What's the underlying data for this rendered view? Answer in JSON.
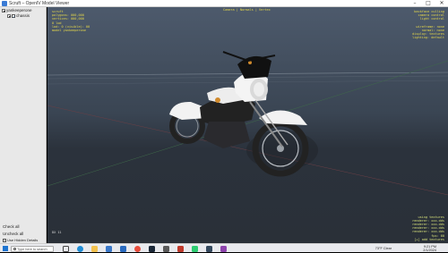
{
  "window": {
    "title": "Scruft – OpenIV Model Viewer",
    "min_glyph": "–",
    "max_glyph": "□",
    "close_glyph": "✕"
  },
  "tree": {
    "root": "yankeeperone",
    "child": "chassis",
    "check_glyph": "✓"
  },
  "sidebar": {
    "check_all": "Check all",
    "uncheck_all": "Uncheck all",
    "hide_option": "Use Hidden Details"
  },
  "hud": {
    "top": "Camera | Normals | Vertex",
    "left": "scruft\npolygons: 000,000\nvertices: 000,000\n0 lod\nlod: 0 (visible): 00\nmodel yankeeperone",
    "right": "backface culling\ncamera control\nlight control\n \nwireframe: none\nnormal: none\ndisplay: textures\nlighting: default",
    "bottom_right": "using textures\nrenderer: xxx.dds\nrenderer: xxx.dds\nrenderer: xxx.dds\nrenderer: xxx.dds\nfps: 60\n[+] add textures",
    "bottom_left": "DX 11"
  },
  "taskbar": {
    "search_placeholder": "Type here to search",
    "weather": "73°F Clear",
    "time": "9:21 PM",
    "date": "2/1/2024"
  },
  "colors": {
    "hud": "#e6d84a",
    "viewport": "#3a4553",
    "taskbar": "#e9eaee"
  },
  "icons": [
    "windows-start-icon",
    "search-icon",
    "task-view-icon",
    "edge-icon",
    "file-explorer-icon",
    "store-icon",
    "mail-icon",
    "chrome-icon",
    "steam-icon",
    "game-icon",
    "openiv-icon",
    "app-icon",
    "app-icon",
    "app-icon"
  ]
}
